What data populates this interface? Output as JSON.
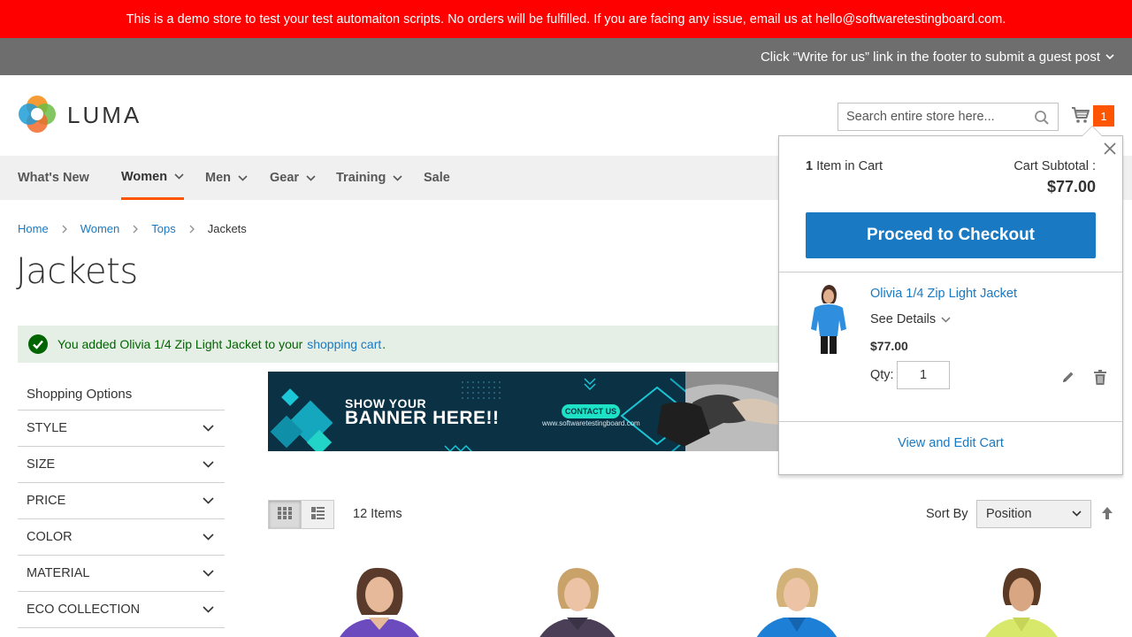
{
  "demo_notice": "This is a demo store to test your test automaiton scripts. No orders will be fulfilled. If you are facing any issue, email us at hello@softwaretestingboard.com.",
  "promo_notice": "Click “Write for us” link in the footer to submit a guest post",
  "logo": {
    "text": "LUMA"
  },
  "search": {
    "placeholder": "Search entire store here..."
  },
  "cart": {
    "count": "1"
  },
  "nav": [
    {
      "label": "What's New"
    },
    {
      "label": "Women"
    },
    {
      "label": "Men"
    },
    {
      "label": "Gear"
    },
    {
      "label": "Training"
    },
    {
      "label": "Sale"
    }
  ],
  "breadcrumbs": [
    "Home",
    "Women",
    "Tops",
    "Jackets"
  ],
  "page_title": "Jackets",
  "message": {
    "prefix": "You added Olivia 1/4 Zip Light Jacket to your",
    "link": "shopping cart",
    "suffix": "."
  },
  "sidebar": {
    "title": "Shopping Options",
    "filters": [
      "Style",
      "Size",
      "Price",
      "Color",
      "Material",
      "Eco Collection"
    ]
  },
  "banner": {
    "line1": "SHOW YOUR",
    "line2": "BANNER HERE!!",
    "cta": "CONTACT US",
    "url": "www.softwaretestingboard.com"
  },
  "toolbar": {
    "amount": "12 Items",
    "sort_label": "Sort By",
    "sort_value": "Position"
  },
  "minicart": {
    "item_count": "1",
    "items_label": "Item in Cart",
    "subtotal_label": "Cart Subtotal :",
    "subtotal": "$77.00",
    "checkout_label": "Proceed to Checkout",
    "product_name": "Olivia 1/4 Zip Light Jacket",
    "see_details": "See Details",
    "product_price": "$77.00",
    "qty_label": "Qty:",
    "qty_value": "1",
    "view_edit_label": "View and Edit Cart"
  },
  "colors": {
    "demo_bar": "#ff0000",
    "promo_bar": "#6e6e6e",
    "accent": "#ff5501",
    "link": "#1979c3",
    "success_bg": "#e5efe5"
  }
}
